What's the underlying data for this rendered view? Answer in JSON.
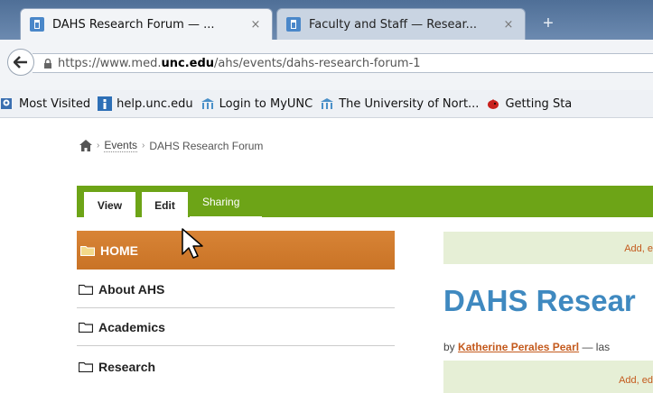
{
  "browser": {
    "tabs": [
      {
        "title": "DAHS Research Forum — ...",
        "close": "×"
      },
      {
        "title": "Faculty and Staff — Resear...",
        "close": "×"
      }
    ],
    "new_tab": "+",
    "url": {
      "scheme": "https://www.med.",
      "domain": "unc.edu",
      "path": "/ahs/events/dahs-research-forum-1"
    },
    "bookmarks": [
      {
        "label": "Most Visited",
        "icon": "bookmarks-icon"
      },
      {
        "label": "help.unc.edu",
        "icon": "info-icon"
      },
      {
        "label": "Login to MyUNC",
        "icon": "unc-well-icon"
      },
      {
        "label": "The University of Nort...",
        "icon": "unc-well-icon"
      },
      {
        "label": "Getting Sta",
        "icon": "bird-icon"
      }
    ]
  },
  "breadcrumb": {
    "home_icon": "home-icon",
    "sep": "›",
    "items": [
      "Events",
      "DAHS Research Forum"
    ]
  },
  "content_tabs": {
    "view": "View",
    "edit": "Edit",
    "sharing": "Sharing"
  },
  "nav": {
    "items": [
      "HOME",
      "About AHS",
      "Academics",
      "Research"
    ]
  },
  "main": {
    "notice1": "Add, e",
    "title": "DAHS Resear",
    "byline_prefix": "by",
    "author": "Katherine Perales Pearl",
    "byline_suffix": " — las",
    "notice2": "Add, ed"
  },
  "colors": {
    "green_bar": "#6da417",
    "home_orange": "#d07b2e",
    "heading_blue": "#3f89c0",
    "link_orange": "#c45a1d"
  }
}
